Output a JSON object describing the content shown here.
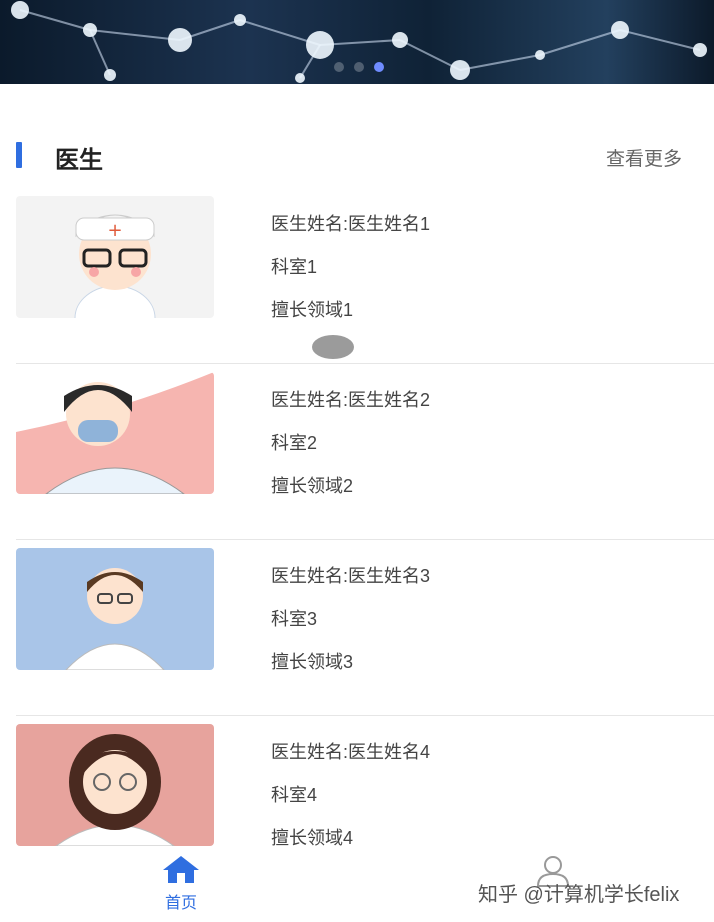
{
  "banner": {
    "carousel_total": 3,
    "carousel_active": 3
  },
  "section": {
    "title": "医生",
    "see_more": "查看更多"
  },
  "doctors": [
    {
      "name_line": "医生姓名:医生姓名1",
      "department": "科室1",
      "specialty": "擅长领域1",
      "avatar_bg": "#f3f3f3"
    },
    {
      "name_line": "医生姓名:医生姓名2",
      "department": "科室2",
      "specialty": "擅长领域2",
      "avatar_bg": "#f6b5b0"
    },
    {
      "name_line": "医生姓名:医生姓名3",
      "department": "科室3",
      "specialty": "擅长领域3",
      "avatar_bg": "#a9c5e8"
    },
    {
      "name_line": "医生姓名:医生姓名4",
      "department": "科室4",
      "specialty": "擅长领域4",
      "avatar_bg": "#e7a39d"
    }
  ],
  "nav": {
    "home_label": "首页",
    "home_icon": "home-icon",
    "user_icon": "user-icon"
  },
  "watermark": "知乎 @计算机学长felix",
  "colors": {
    "accent": "#2f6ee0"
  }
}
